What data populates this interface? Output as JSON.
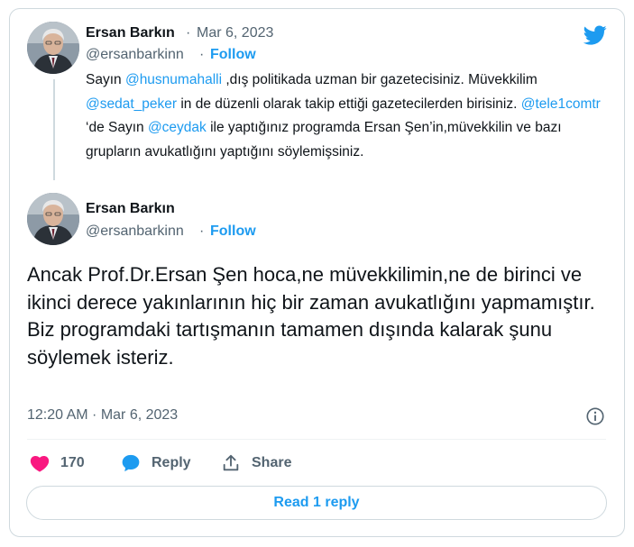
{
  "brand_color": "#1d9bf0",
  "quoted_tweet": {
    "author_name": "Ersan Barkın",
    "separator": "·",
    "date": "Mar 6, 2023",
    "handle": "@ersanbarkinn",
    "follow_label": "Follow",
    "text_segments": [
      {
        "text": "Sayın ",
        "type": "text"
      },
      {
        "text": "@husnumahalli",
        "type": "mention"
      },
      {
        "text": " ,dış politikada uzman bir gazetecisiniz. Müvekkilim ",
        "type": "text"
      },
      {
        "text": "@sedat_peker",
        "type": "mention"
      },
      {
        "text": " in de düzenli olarak takip ettiği gazetecilerden birisiniz. ",
        "type": "text"
      },
      {
        "text": "@tele1comtr",
        "type": "mention"
      },
      {
        "text": " ‘de Sayın ",
        "type": "text"
      },
      {
        "text": "@ceydak",
        "type": "mention"
      },
      {
        "text": " ile yaptığınız programda Ersan Şen’in,müvekkilin ve bazı grupların avukatlığını yaptığını söylemişsiniz.",
        "type": "text"
      }
    ]
  },
  "main_tweet": {
    "author_name": "Ersan Barkın",
    "handle": "@ersanbarkinn",
    "separator": "·",
    "follow_label": "Follow",
    "text": "Ancak Prof.Dr.Ersan Şen hoca,ne müvekkilimin,ne de birinci ve ikinci derece yakınlarının hiç bir zaman avukatlığını yapmamıştır.\nBiz programdaki tartışmanın tamamen dışında kalarak şunu söylemek isteriz.",
    "timestamp": "12:20 AM · Mar 6, 2023"
  },
  "actions": {
    "like_count": "170",
    "reply_label": "Reply",
    "share_label": "Share"
  },
  "read_replies_label": "Read 1 reply",
  "icons": {
    "logo": "twitter-bird-icon",
    "like": "heart-icon",
    "reply": "speech-bubble-icon",
    "share": "share-upload-icon",
    "info": "info-icon"
  }
}
